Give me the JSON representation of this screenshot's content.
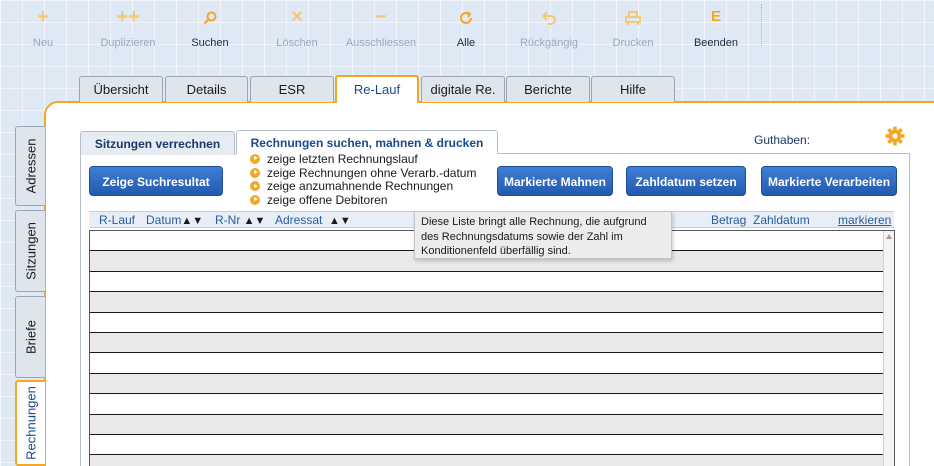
{
  "toolbar": {
    "items": [
      {
        "label": "Neu",
        "icon": "plus-icon"
      },
      {
        "label": "Duplizieren",
        "icon": "double-plus-icon"
      },
      {
        "label": "Suchen",
        "icon": "search-icon"
      },
      {
        "label": "Löschen",
        "icon": "close-icon"
      },
      {
        "label": "Ausschliessen",
        "icon": "minus-icon"
      },
      {
        "label": "Alle",
        "icon": "refresh-icon"
      },
      {
        "label": "Rückgängig",
        "icon": "undo-icon"
      },
      {
        "label": "Drucken",
        "icon": "printer-icon"
      },
      {
        "label": "Beenden",
        "icon": "exit-icon"
      }
    ]
  },
  "top_tabs": [
    "Übersicht",
    "Details",
    "ESR",
    "Re-Lauf",
    "digitale Re.",
    "Berichte",
    "Hilfe"
  ],
  "top_tabs_active": "Re-Lauf",
  "side_tabs": [
    "Adressen",
    "Sitzungen",
    "Briefe",
    "Rechnungen"
  ],
  "side_tabs_active": "Rechnungen",
  "sub_tabs": [
    "Sitzungen verrechnen",
    "Rechnungen suchen, mahnen & drucken"
  ],
  "guthaben_label": "Guthaben:",
  "buttons": {
    "show_results": "Zeige Suchresultat",
    "mark_reminder": "Markierte Mahnen",
    "set_payment_date": "Zahldatum setzen",
    "mark_process": "Markierte Verarbeiten"
  },
  "options": [
    "zeige letzten Rechnungslauf",
    "zeige Rechnungen ohne Verarb.-datum",
    "zeige anzumahnende Rechnungen",
    "zeige offene Debitoren"
  ],
  "columns": {
    "rlauf": "R-Lauf",
    "datum": "Datum",
    "rnr": "R-Nr",
    "adressat": "Adressat",
    "betrag": "Betrag",
    "zahldatum": "Zahldatum",
    "markieren": "markieren",
    "sort_arrows": "▲▼"
  },
  "tooltip": "Diese Liste bringt alle Rechnung, die aufgrund des Rechnungsdatums sowie der Zahl im Konditionenfeld überfällig sind.",
  "colors": {
    "accent": "#f5a623",
    "button_blue": "#2f6cc4",
    "link_blue": "#2a5aa0"
  }
}
